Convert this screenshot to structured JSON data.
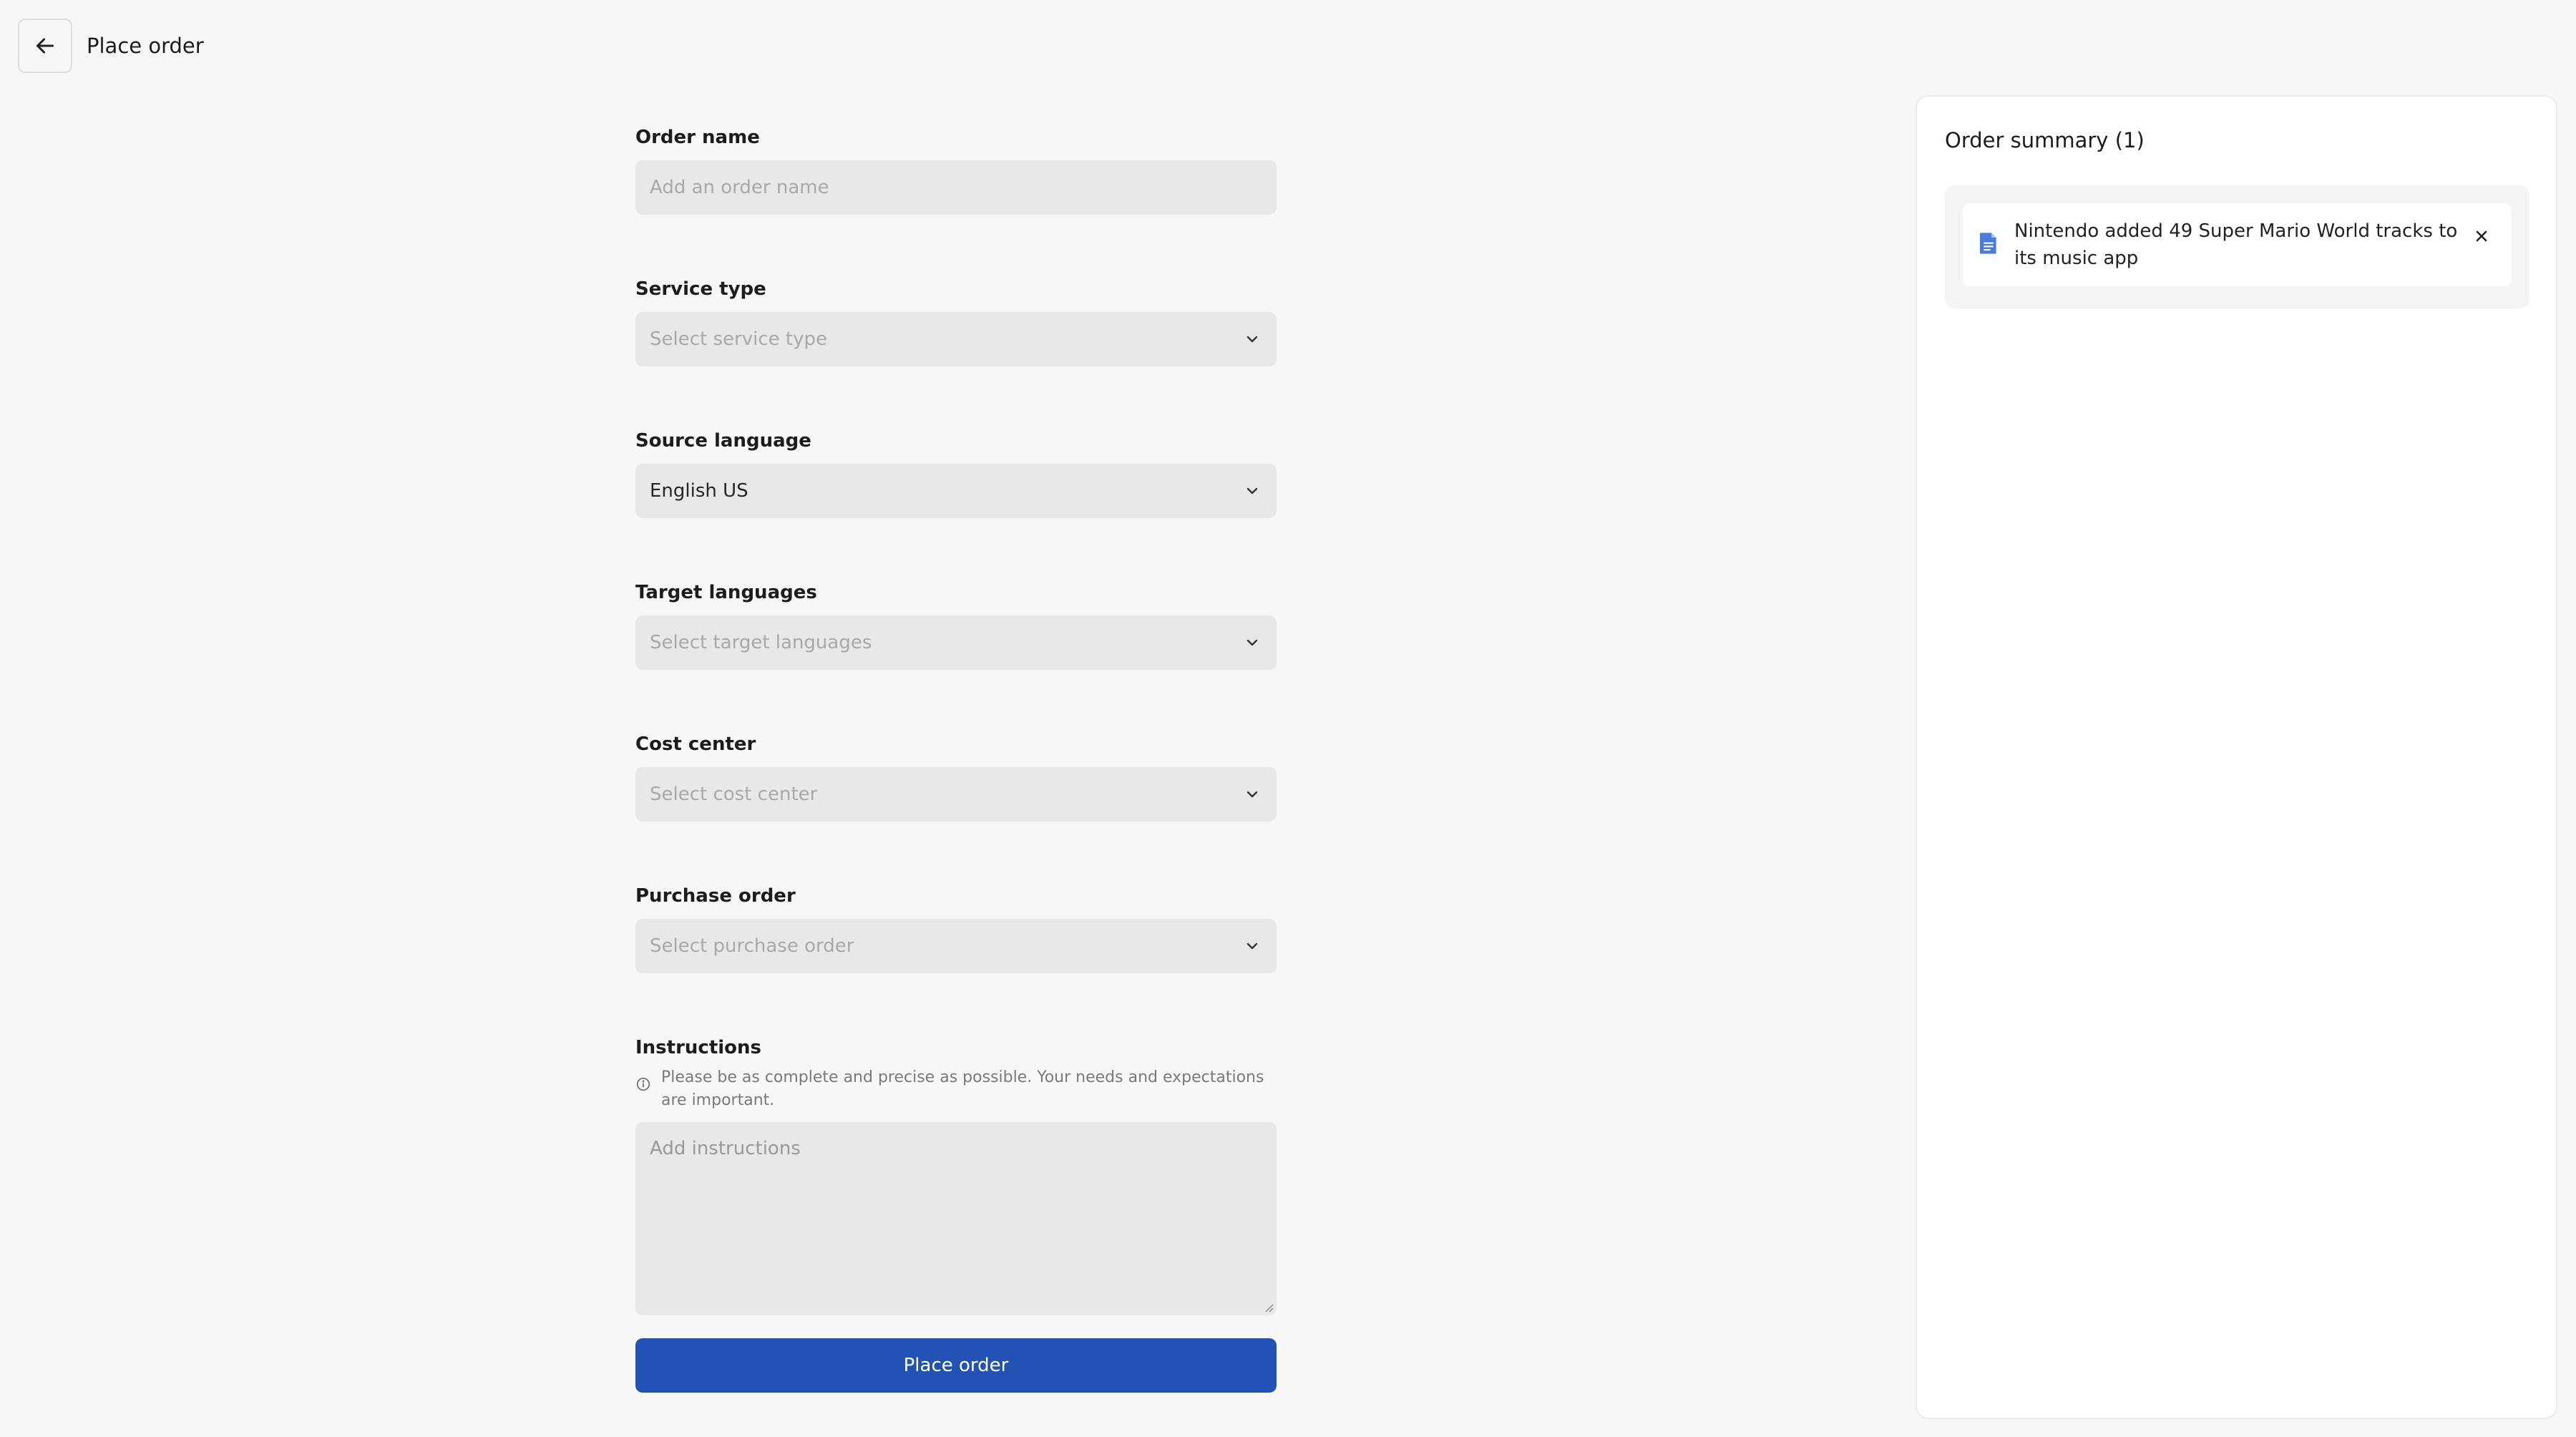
{
  "header": {
    "title": "Place order"
  },
  "form": {
    "order_name": {
      "label": "Order name",
      "placeholder": "Add an order name"
    },
    "service_type": {
      "label": "Service type",
      "placeholder": "Select service type"
    },
    "source_language": {
      "label": "Source language",
      "value": "English US"
    },
    "target_languages": {
      "label": "Target languages",
      "placeholder": "Select target languages"
    },
    "cost_center": {
      "label": "Cost center",
      "placeholder": "Select cost center"
    },
    "purchase_order": {
      "label": "Purchase order",
      "placeholder": "Select purchase order"
    },
    "instructions": {
      "label": "Instructions",
      "hint": "Please be as complete and precise as possible. Your needs and expectations are important.",
      "placeholder": "Add instructions"
    },
    "submit_label": "Place order"
  },
  "summary": {
    "title": "Order summary (1)",
    "items": [
      {
        "title": "Nintendo added 49 Super Mario World tracks to its music app"
      }
    ]
  },
  "colors": {
    "background": "#f7f7f7",
    "field_bg": "#e8e8e8",
    "primary": "#2252b3",
    "doc_icon": "#4a7bdc"
  }
}
